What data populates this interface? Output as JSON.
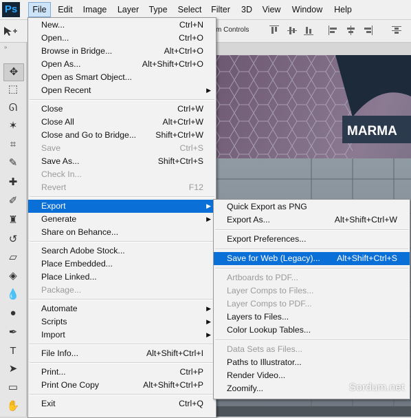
{
  "app": {
    "logo": "Ps"
  },
  "menubar": [
    "File",
    "Edit",
    "Image",
    "Layer",
    "Type",
    "Select",
    "Filter",
    "3D",
    "View",
    "Window",
    "Help"
  ],
  "options_bar": {
    "visible_text": "m Controls"
  },
  "canvas": {
    "sign_text": "MARMA"
  },
  "file_menu": [
    {
      "label": "New...",
      "shortcut": "Ctrl+N"
    },
    {
      "label": "Open...",
      "shortcut": "Ctrl+O"
    },
    {
      "label": "Browse in Bridge...",
      "shortcut": "Alt+Ctrl+O"
    },
    {
      "label": "Open As...",
      "shortcut": "Alt+Shift+Ctrl+O"
    },
    {
      "label": "Open as Smart Object...",
      "shortcut": ""
    },
    {
      "label": "Open Recent",
      "shortcut": "",
      "submenu": true
    },
    {
      "separator": true
    },
    {
      "label": "Close",
      "shortcut": "Ctrl+W"
    },
    {
      "label": "Close All",
      "shortcut": "Alt+Ctrl+W"
    },
    {
      "label": "Close and Go to Bridge...",
      "shortcut": "Shift+Ctrl+W"
    },
    {
      "label": "Save",
      "shortcut": "Ctrl+S",
      "disabled": true
    },
    {
      "label": "Save As...",
      "shortcut": "Shift+Ctrl+S"
    },
    {
      "label": "Check In...",
      "shortcut": "",
      "disabled": true
    },
    {
      "label": "Revert",
      "shortcut": "F12",
      "disabled": true
    },
    {
      "separator": true
    },
    {
      "label": "Export",
      "shortcut": "",
      "submenu": true,
      "highlighted": true
    },
    {
      "label": "Generate",
      "shortcut": "",
      "submenu": true
    },
    {
      "label": "Share on Behance...",
      "shortcut": ""
    },
    {
      "separator": true
    },
    {
      "label": "Search Adobe Stock...",
      "shortcut": ""
    },
    {
      "label": "Place Embedded...",
      "shortcut": ""
    },
    {
      "label": "Place Linked...",
      "shortcut": ""
    },
    {
      "label": "Package...",
      "shortcut": "",
      "disabled": true
    },
    {
      "separator": true
    },
    {
      "label": "Automate",
      "shortcut": "",
      "submenu": true
    },
    {
      "label": "Scripts",
      "shortcut": "",
      "submenu": true
    },
    {
      "label": "Import",
      "shortcut": "",
      "submenu": true
    },
    {
      "separator": true
    },
    {
      "label": "File Info...",
      "shortcut": "Alt+Shift+Ctrl+I"
    },
    {
      "separator": true
    },
    {
      "label": "Print...",
      "shortcut": "Ctrl+P"
    },
    {
      "label": "Print One Copy",
      "shortcut": "Alt+Shift+Ctrl+P"
    },
    {
      "separator": true
    },
    {
      "label": "Exit",
      "shortcut": "Ctrl+Q"
    }
  ],
  "export_submenu": [
    {
      "label": "Quick Export as PNG",
      "shortcut": ""
    },
    {
      "label": "Export As...",
      "shortcut": "Alt+Shift+Ctrl+W"
    },
    {
      "separator": true
    },
    {
      "label": "Export Preferences...",
      "shortcut": ""
    },
    {
      "separator": true
    },
    {
      "label": "Save for Web (Legacy)...",
      "shortcut": "Alt+Shift+Ctrl+S",
      "highlighted": true
    },
    {
      "separator": true
    },
    {
      "label": "Artboards to PDF...",
      "shortcut": "",
      "disabled": true
    },
    {
      "label": "Layer Comps to Files...",
      "shortcut": "",
      "disabled": true
    },
    {
      "label": "Layer Comps to PDF...",
      "shortcut": "",
      "disabled": true
    },
    {
      "label": "Layers to Files...",
      "shortcut": ""
    },
    {
      "label": "Color Lookup Tables...",
      "shortcut": ""
    },
    {
      "separator": true
    },
    {
      "label": "Data Sets as Files...",
      "shortcut": "",
      "disabled": true
    },
    {
      "label": "Paths to Illustrator...",
      "shortcut": ""
    },
    {
      "label": "Render Video...",
      "shortcut": ""
    },
    {
      "label": "Zoomify...",
      "shortcut": ""
    }
  ],
  "tools": [
    {
      "name": "move-tool-icon",
      "glyph": "✥"
    },
    {
      "name": "marquee-tool-icon",
      "glyph": "⬚"
    },
    {
      "name": "lasso-tool-icon",
      "glyph": "ᘏ"
    },
    {
      "name": "magic-wand-tool-icon",
      "glyph": "✶"
    },
    {
      "name": "crop-tool-icon",
      "glyph": "⌗"
    },
    {
      "name": "eyedropper-tool-icon",
      "glyph": "✎"
    },
    {
      "name": "healing-brush-tool-icon",
      "glyph": "✚"
    },
    {
      "name": "brush-tool-icon",
      "glyph": "✐"
    },
    {
      "name": "clone-stamp-tool-icon",
      "glyph": "♜"
    },
    {
      "name": "history-brush-tool-icon",
      "glyph": "↺"
    },
    {
      "name": "eraser-tool-icon",
      "glyph": "▱"
    },
    {
      "name": "paint-bucket-tool-icon",
      "glyph": "◈"
    },
    {
      "name": "blur-tool-icon",
      "glyph": "💧"
    },
    {
      "name": "dodge-tool-icon",
      "glyph": "●"
    },
    {
      "name": "pen-tool-icon",
      "glyph": "✒"
    },
    {
      "name": "type-tool-icon",
      "glyph": "T"
    },
    {
      "name": "path-selection-tool-icon",
      "glyph": "➤"
    },
    {
      "name": "rectangle-tool-icon",
      "glyph": "▭"
    },
    {
      "name": "hand-tool-icon",
      "glyph": "✋"
    }
  ],
  "watermark": "Sordum.net"
}
